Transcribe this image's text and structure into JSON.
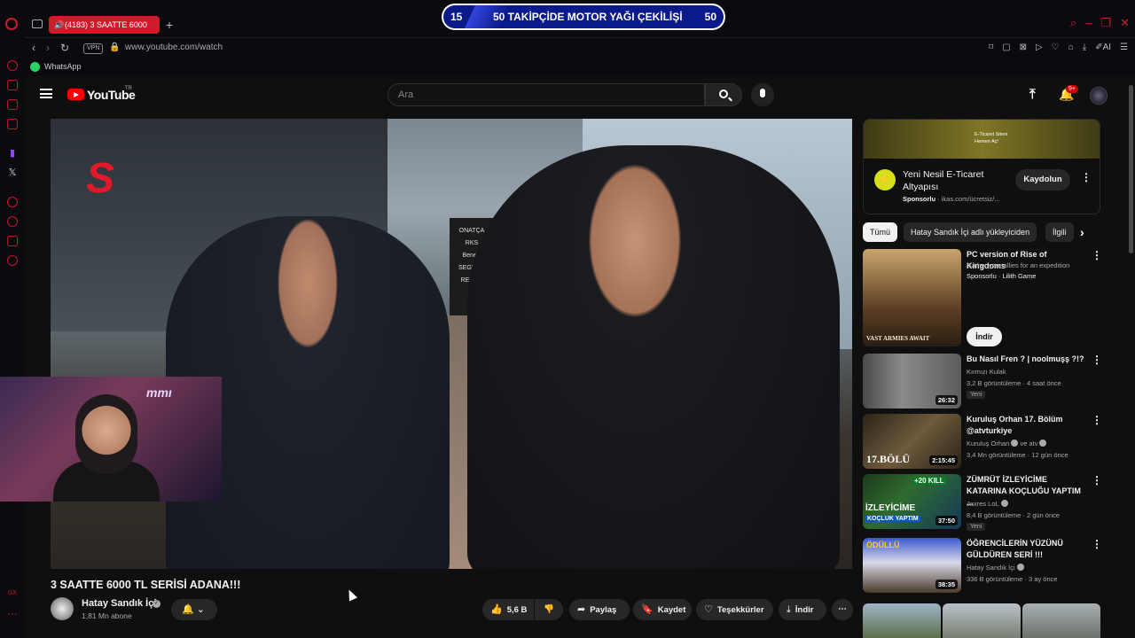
{
  "browser": {
    "tab_title": "(4183) 3 SAATTE 6000",
    "url": "www.youtube.com/watch",
    "vpn_label": "VPN",
    "ai_label": "AI",
    "bookmark_whatsapp": "WhatsApp",
    "accent_color": "#d11a2a",
    "sidebar_bottom_label": "GX"
  },
  "stream_banner": {
    "left_count": "15",
    "text": "50 TAKİPÇİDE MOTOR YAĞI ÇEKİLİŞİ",
    "right_count": "50"
  },
  "youtube": {
    "wordmark": "YouTube",
    "country": "TR",
    "search_placeholder": "Ara",
    "notif_count": "9+"
  },
  "video": {
    "storefront_logo": "S",
    "sign_text": "ONATÇA\nRKS\nBenelli\nSEGWAY\nRELIVE",
    "title": "3 SAATTE 6000 TL SERİSİ ADANA!!!",
    "channel_name": "Hatay Sandık İçi",
    "subscribers": "1,81 Mn abone",
    "likes": "5,6 B",
    "share_label": "Paylaş",
    "save_label": "Kaydet",
    "thanks_label": "Teşekkürler",
    "download_label": "İndir"
  },
  "webcam": {
    "overlay_text": "mmı"
  },
  "ad": {
    "banner_text": "E-Ticaret Siteni Hemen Aç!",
    "logo_brand": "ikas",
    "title": "Yeni Nesil E-Ticaret Altyapısı",
    "sponsored_label": "Sponsorlu",
    "domain": "ikas.com/ücretsiz/...",
    "subscribe_label": "Kaydolun"
  },
  "chips": [
    "Tümü",
    "Hatay Sandık İçi adlı yükleyiciden",
    "İlgili"
  ],
  "recommendations": [
    {
      "title": "PC version of Rise of Kingdoms",
      "line2": "Gather your allies for an expedition",
      "channel": "Sponsorlu · Lilith Game",
      "thumb_text": "VAST ARMIES AWAIT",
      "install_label": "İndir"
    },
    {
      "title": "Bu Nasıl Fren ? | noolmuşş ?!?",
      "channel": "Kırmızı Kulak",
      "views": "3,2 B görüntüleme · 4 saat önce",
      "new_badge": "Yeni",
      "duration": "26:32"
    },
    {
      "title": "Kuruluş Orhan 17. Bölüm @atvturkiye",
      "channel": "Kuruluş Orhan",
      "channel2": "ve atv",
      "views": "3,4 Mn görüntüleme · 12 gün önce",
      "duration": "2:15:45",
      "thumb_text": "17.BÖLÜ"
    },
    {
      "title": "ZÜMRÜT İZLEYİCİME KATARINA KOÇLUĞU YAPTIM ...",
      "channel": "Jaxres LoL",
      "views": "8,4 B görüntüleme · 2 gün önce",
      "new_badge": "Yeni",
      "duration": "37:50",
      "thumb_text": "İZLEYİCİME",
      "thumb_text2": "KOÇLUK YAPTIM",
      "thumb_badge": "+20 KILL"
    },
    {
      "title": "ÖĞRENCİLERİN YÜZÜNÜ GÜLDÜREN SERİ !!!",
      "channel": "Hatay Sandık İçi",
      "views": "336 B görüntüleme · 3 ay önce",
      "duration": "38:35",
      "thumb_text": "ÖDÜLLÜ"
    }
  ]
}
